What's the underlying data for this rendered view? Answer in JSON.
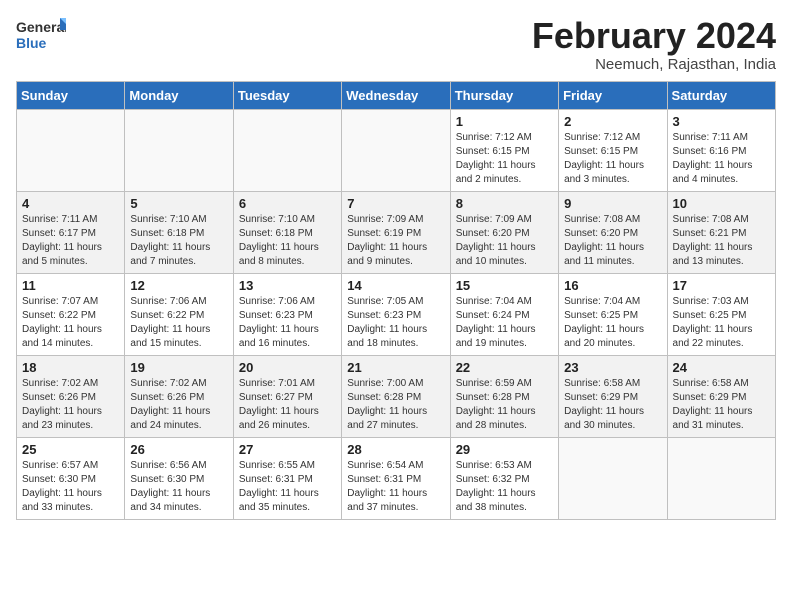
{
  "logo": {
    "general": "General",
    "blue": "Blue"
  },
  "title": "February 2024",
  "subtitle": "Neemuch, Rajasthan, India",
  "weekdays": [
    "Sunday",
    "Monday",
    "Tuesday",
    "Wednesday",
    "Thursday",
    "Friday",
    "Saturday"
  ],
  "weeks": [
    [
      {
        "day": "",
        "info": ""
      },
      {
        "day": "",
        "info": ""
      },
      {
        "day": "",
        "info": ""
      },
      {
        "day": "",
        "info": ""
      },
      {
        "day": "1",
        "info": "Sunrise: 7:12 AM\nSunset: 6:15 PM\nDaylight: 11 hours and 2 minutes."
      },
      {
        "day": "2",
        "info": "Sunrise: 7:12 AM\nSunset: 6:15 PM\nDaylight: 11 hours and 3 minutes."
      },
      {
        "day": "3",
        "info": "Sunrise: 7:11 AM\nSunset: 6:16 PM\nDaylight: 11 hours and 4 minutes."
      }
    ],
    [
      {
        "day": "4",
        "info": "Sunrise: 7:11 AM\nSunset: 6:17 PM\nDaylight: 11 hours and 5 minutes."
      },
      {
        "day": "5",
        "info": "Sunrise: 7:10 AM\nSunset: 6:18 PM\nDaylight: 11 hours and 7 minutes."
      },
      {
        "day": "6",
        "info": "Sunrise: 7:10 AM\nSunset: 6:18 PM\nDaylight: 11 hours and 8 minutes."
      },
      {
        "day": "7",
        "info": "Sunrise: 7:09 AM\nSunset: 6:19 PM\nDaylight: 11 hours and 9 minutes."
      },
      {
        "day": "8",
        "info": "Sunrise: 7:09 AM\nSunset: 6:20 PM\nDaylight: 11 hours and 10 minutes."
      },
      {
        "day": "9",
        "info": "Sunrise: 7:08 AM\nSunset: 6:20 PM\nDaylight: 11 hours and 11 minutes."
      },
      {
        "day": "10",
        "info": "Sunrise: 7:08 AM\nSunset: 6:21 PM\nDaylight: 11 hours and 13 minutes."
      }
    ],
    [
      {
        "day": "11",
        "info": "Sunrise: 7:07 AM\nSunset: 6:22 PM\nDaylight: 11 hours and 14 minutes."
      },
      {
        "day": "12",
        "info": "Sunrise: 7:06 AM\nSunset: 6:22 PM\nDaylight: 11 hours and 15 minutes."
      },
      {
        "day": "13",
        "info": "Sunrise: 7:06 AM\nSunset: 6:23 PM\nDaylight: 11 hours and 16 minutes."
      },
      {
        "day": "14",
        "info": "Sunrise: 7:05 AM\nSunset: 6:23 PM\nDaylight: 11 hours and 18 minutes."
      },
      {
        "day": "15",
        "info": "Sunrise: 7:04 AM\nSunset: 6:24 PM\nDaylight: 11 hours and 19 minutes."
      },
      {
        "day": "16",
        "info": "Sunrise: 7:04 AM\nSunset: 6:25 PM\nDaylight: 11 hours and 20 minutes."
      },
      {
        "day": "17",
        "info": "Sunrise: 7:03 AM\nSunset: 6:25 PM\nDaylight: 11 hours and 22 minutes."
      }
    ],
    [
      {
        "day": "18",
        "info": "Sunrise: 7:02 AM\nSunset: 6:26 PM\nDaylight: 11 hours and 23 minutes."
      },
      {
        "day": "19",
        "info": "Sunrise: 7:02 AM\nSunset: 6:26 PM\nDaylight: 11 hours and 24 minutes."
      },
      {
        "day": "20",
        "info": "Sunrise: 7:01 AM\nSunset: 6:27 PM\nDaylight: 11 hours and 26 minutes."
      },
      {
        "day": "21",
        "info": "Sunrise: 7:00 AM\nSunset: 6:28 PM\nDaylight: 11 hours and 27 minutes."
      },
      {
        "day": "22",
        "info": "Sunrise: 6:59 AM\nSunset: 6:28 PM\nDaylight: 11 hours and 28 minutes."
      },
      {
        "day": "23",
        "info": "Sunrise: 6:58 AM\nSunset: 6:29 PM\nDaylight: 11 hours and 30 minutes."
      },
      {
        "day": "24",
        "info": "Sunrise: 6:58 AM\nSunset: 6:29 PM\nDaylight: 11 hours and 31 minutes."
      }
    ],
    [
      {
        "day": "25",
        "info": "Sunrise: 6:57 AM\nSunset: 6:30 PM\nDaylight: 11 hours and 33 minutes."
      },
      {
        "day": "26",
        "info": "Sunrise: 6:56 AM\nSunset: 6:30 PM\nDaylight: 11 hours and 34 minutes."
      },
      {
        "day": "27",
        "info": "Sunrise: 6:55 AM\nSunset: 6:31 PM\nDaylight: 11 hours and 35 minutes."
      },
      {
        "day": "28",
        "info": "Sunrise: 6:54 AM\nSunset: 6:31 PM\nDaylight: 11 hours and 37 minutes."
      },
      {
        "day": "29",
        "info": "Sunrise: 6:53 AM\nSunset: 6:32 PM\nDaylight: 11 hours and 38 minutes."
      },
      {
        "day": "",
        "info": ""
      },
      {
        "day": "",
        "info": ""
      }
    ]
  ]
}
